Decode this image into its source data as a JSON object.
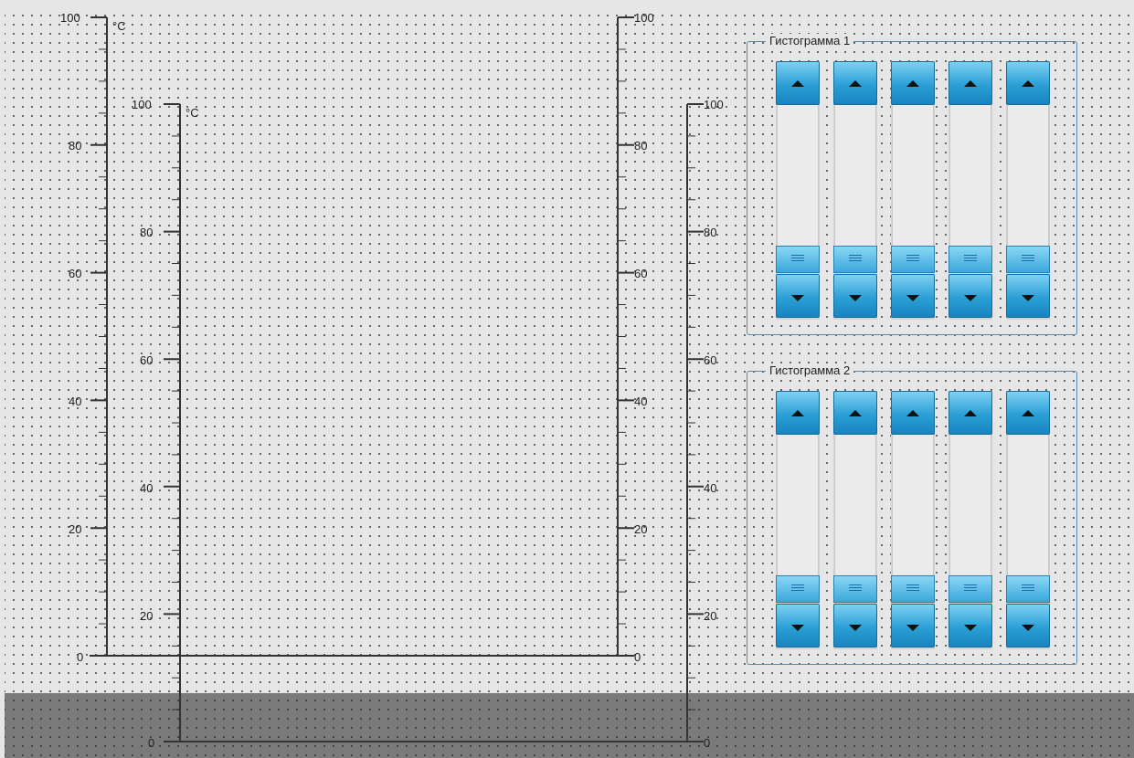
{
  "scale_outer_left": {
    "unit": "°C",
    "labels": [
      "100",
      "80",
      "60",
      "40",
      "20",
      "0"
    ]
  },
  "scale_outer_right": {
    "labels": [
      "100",
      "80",
      "60",
      "40",
      "20",
      "0"
    ]
  },
  "scale_inner_left": {
    "unit": "°C",
    "labels": [
      "100",
      "80",
      "60",
      "40",
      "20",
      "0"
    ]
  },
  "scale_inner_right": {
    "labels": [
      "100",
      "80",
      "60",
      "40",
      "20",
      "0"
    ]
  },
  "panels": [
    {
      "title": "Гистограмма 1",
      "bars": 5
    },
    {
      "title": "Гистограмма 2",
      "bars": 5
    }
  ],
  "icons": {
    "up": "arrow-up-icon",
    "down": "arrow-down-icon",
    "grip": "grip-icon"
  },
  "colors": {
    "background": "#e6e6e6",
    "button_accent": "#2b9fd6",
    "panel_border": "#5d8aa8",
    "scale_line": "#333333"
  }
}
